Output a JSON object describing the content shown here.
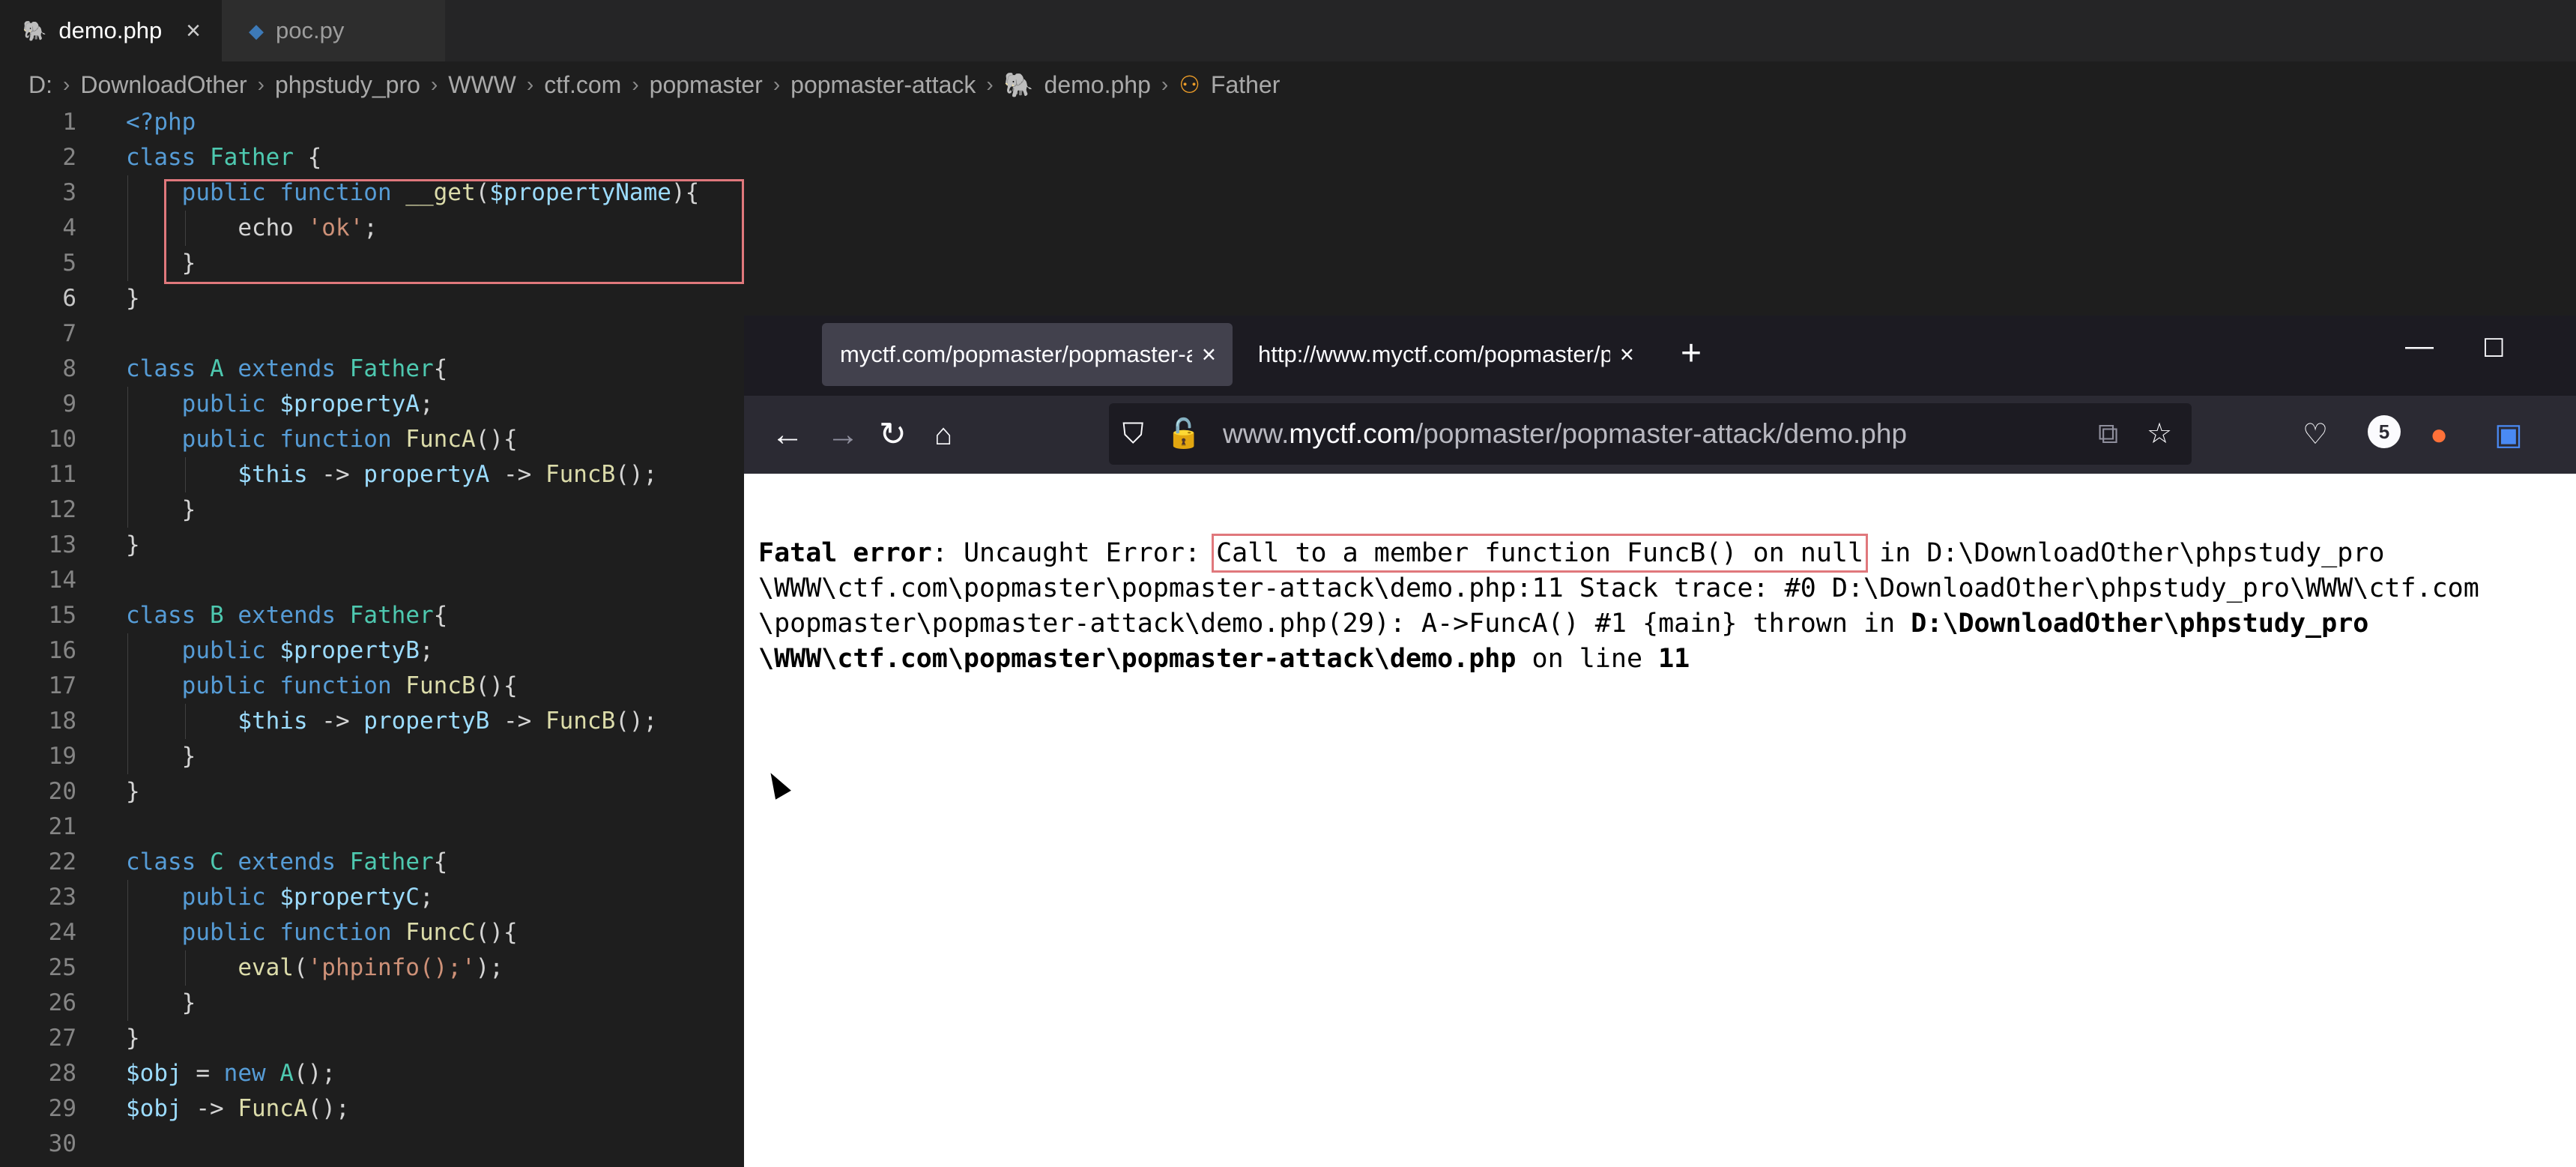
{
  "editor": {
    "tabs": [
      {
        "label": "demo.php",
        "icon": "php-elephant-icon",
        "active": true,
        "close": "×"
      },
      {
        "label": "poc.py",
        "icon": "python-icon",
        "active": false
      }
    ],
    "breadcrumb": [
      "D:",
      "DownloadOther",
      "phpstudy_pro",
      "WWW",
      "ctf.com",
      "popmaster",
      "popmaster-attack",
      "demo.php",
      "Father"
    ],
    "line_numbers": [
      "1",
      "2",
      "3",
      "4",
      "5",
      "6",
      "7",
      "8",
      "9",
      "10",
      "11",
      "12",
      "13",
      "14",
      "15",
      "16",
      "17",
      "18",
      "19",
      "20",
      "21",
      "22",
      "23",
      "24",
      "25",
      "26",
      "27",
      "28",
      "29",
      "30"
    ],
    "code": {
      "l1": "<?php",
      "l2_kw": "class",
      "l2_name": "Father",
      "l2_brace": " {",
      "l3_kw1": "public",
      "l3_kw2": "function",
      "l3_fn": "__get",
      "l3_open": "(",
      "l3_var": "$propertyName",
      "l3_close": "){",
      "l4_fn": "echo",
      "l4_str": "'ok'",
      "l4_end": ";",
      "l5": "}",
      "l6": "}",
      "l8_kw": "class",
      "l8_name": "A",
      "l8_ext": "extends",
      "l8_parent": "Father",
      "l8_brace": "{",
      "l9_kw": "public",
      "l9_var": "$propertyA",
      "l9_end": ";",
      "l10_kw1": "public",
      "l10_kw2": "function",
      "l10_fn": "FuncA",
      "l10_end": "(){",
      "l11_this": "$this",
      "l11_arrow1": " -> ",
      "l11_prop": "propertyA",
      "l11_arrow2": " -> ",
      "l11_fn": "FuncB",
      "l11_end": "();",
      "l12": "}",
      "l13": "}",
      "l15_kw": "class",
      "l15_name": "B",
      "l15_ext": "extends",
      "l15_parent": "Father",
      "l15_brace": "{",
      "l16_kw": "public",
      "l16_var": "$propertyB",
      "l16_end": ";",
      "l17_kw1": "public",
      "l17_kw2": "function",
      "l17_fn": "FuncB",
      "l17_end": "(){",
      "l18_this": "$this",
      "l18_arrow1": " -> ",
      "l18_prop": "propertyB",
      "l18_arrow2": " -> ",
      "l18_fn": "FuncB",
      "l18_end": "();",
      "l19": "}",
      "l20": "}",
      "l22_kw": "class",
      "l22_name": "C",
      "l22_ext": "extends",
      "l22_parent": "Father",
      "l22_brace": "{",
      "l23_kw": "public",
      "l23_var": "$propertyC",
      "l23_end": ";",
      "l24_kw1": "public",
      "l24_kw2": "function",
      "l24_fn": "FuncC",
      "l24_end": "(){",
      "l25_fn": "eval",
      "l25_open": "(",
      "l25_str": "'phpinfo();'",
      "l25_end": ");",
      "l26": "}",
      "l27": "}",
      "l28_var": "$obj",
      "l28_eq": " = ",
      "l28_new": "new",
      "l28_cls": "A",
      "l28_end": "();",
      "l29_var": "$obj",
      "l29_arrow": " -> ",
      "l29_fn": "FuncA",
      "l29_end": "();"
    }
  },
  "browser": {
    "tabs": [
      {
        "label": "myctf.com/popmaster/popmaster-attack/demo.php",
        "active": true,
        "close": "×"
      },
      {
        "label": "http://www.myctf.com/popmaster/popmaster-attack/",
        "active": false,
        "close": "×"
      }
    ],
    "new_tab": "+",
    "window_controls": {
      "minimize": "—",
      "maximize": "☐"
    },
    "url": {
      "prefix": "www.",
      "domain": "myctf.com",
      "path": "/popmaster/popmaster-attack/demo.php"
    },
    "extension_badge": "5",
    "error": {
      "label": "Fatal error",
      "colon": ": Uncaught Error: ",
      "message": "Call to a member function FuncB() on null",
      "rest1": " in D:\\DownloadOther\\phpstudy_pro",
      "line2": "\\WWW\\ctf.com\\popmaster\\popmaster-attack\\demo.php:11 Stack trace: #0 D:\\DownloadOther\\phpstudy_pro\\WWW\\ctf.com",
      "line3_pre": "\\popmaster\\popmaster-attack\\demo.php(29): A->FuncA() #1 {main} thrown in ",
      "line3_bold": "D:\\DownloadOther\\phpstudy_pro",
      "line4_bold": "\\WWW\\ctf.com\\popmaster\\popmaster-attack\\demo.php",
      "line4_mid": " on line ",
      "line4_num": "11"
    }
  },
  "colors": {
    "highlight_box": "#e0787c",
    "editor_bg": "#1e1e1e",
    "browser_chrome": "#2b2a33"
  }
}
